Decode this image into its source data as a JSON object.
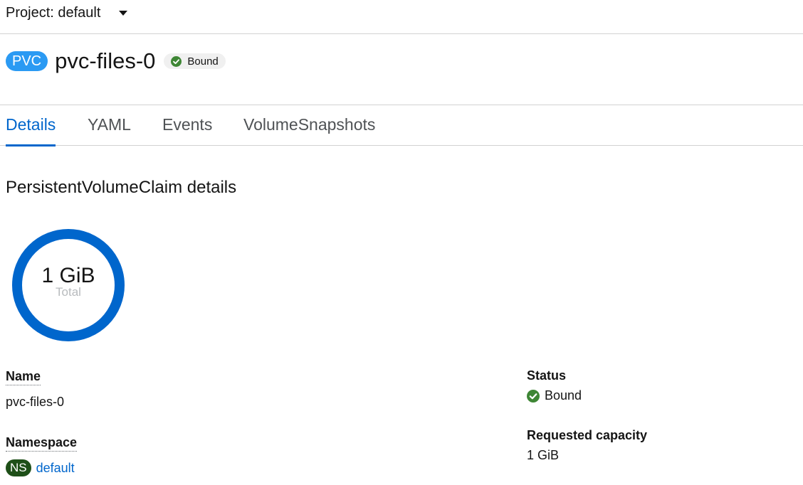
{
  "project_bar": {
    "label": "Project: default"
  },
  "header": {
    "kind_badge": "PVC",
    "title": "pvc-files-0",
    "status": "Bound"
  },
  "tabs": [
    {
      "label": "Details",
      "active": true
    },
    {
      "label": "YAML",
      "active": false
    },
    {
      "label": "Events",
      "active": false
    },
    {
      "label": "VolumeSnapshots",
      "active": false
    }
  ],
  "details": {
    "heading": "PersistentVolumeClaim details",
    "donut": {
      "value": "1 GiB",
      "caption": "Total",
      "ring_color": "#0066cc"
    },
    "name_label": "Name",
    "name_value": "pvc-files-0",
    "namespace_label": "Namespace",
    "namespace_badge": "NS",
    "namespace_value": "default",
    "status_label": "Status",
    "status_value": "Bound",
    "capacity_label": "Requested capacity",
    "capacity_value": "1 GiB"
  },
  "colors": {
    "accent": "#0066cc",
    "pvc_badge": "#2b9af3",
    "ns_badge": "#1e4f18",
    "success": "#3e8635"
  }
}
